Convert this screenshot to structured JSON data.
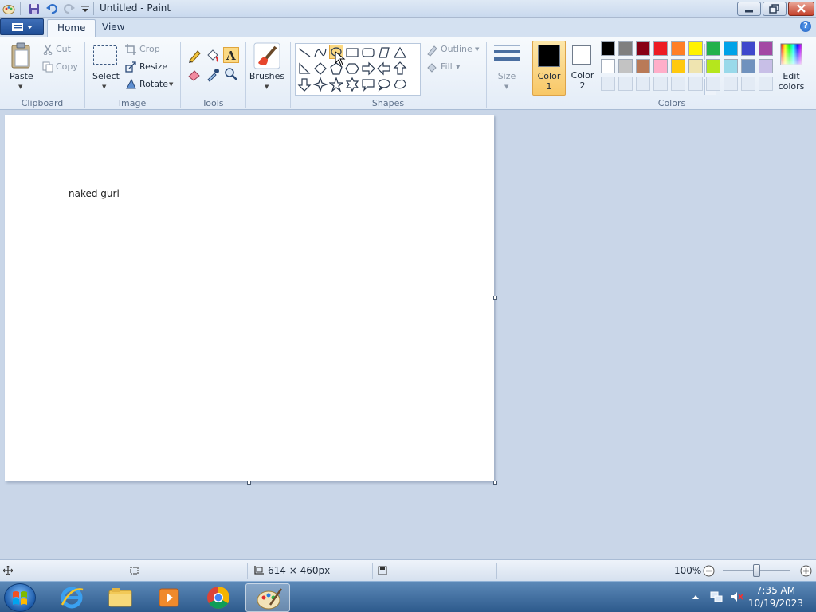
{
  "window": {
    "title": "Untitled - Paint"
  },
  "tabs": {
    "home": "Home",
    "view": "View"
  },
  "ribbon": {
    "clipboard": {
      "paste": "Paste",
      "cut": "Cut",
      "copy": "Copy",
      "group": "Clipboard"
    },
    "image": {
      "select": "Select",
      "crop": "Crop",
      "resize": "Resize",
      "rotate": "Rotate",
      "group": "Image"
    },
    "tools": {
      "group": "Tools"
    },
    "brushes": {
      "label": "Brushes"
    },
    "shapes": {
      "outline": "Outline",
      "fill": "Fill",
      "group": "Shapes"
    },
    "size": {
      "label": "Size"
    },
    "colors": {
      "color1_line1": "Color",
      "color1_line2": "1",
      "color2_line1": "Color",
      "color2_line2": "2",
      "edit_line1": "Edit",
      "edit_line2": "colors",
      "group": "Colors",
      "color1_value": "#000000",
      "color2_value": "#ffffff",
      "palette_row1": [
        "#000000",
        "#7f7f7f",
        "#880015",
        "#ed1c24",
        "#ff7f27",
        "#fff200",
        "#22b14c",
        "#00a2e8",
        "#3f48cc",
        "#a349a4"
      ],
      "palette_row2": [
        "#ffffff",
        "#c3c3c3",
        "#b97a57",
        "#ffaec9",
        "#ffc90e",
        "#efe4b0",
        "#b5e61d",
        "#99d9ea",
        "#7092be",
        "#c8bfe7"
      ]
    }
  },
  "canvas": {
    "text": "naked gurl"
  },
  "status": {
    "dimensions": "614 × 460px",
    "zoom": "100%"
  },
  "taskbar": {
    "time": "7:35 AM",
    "date": "10/19/2023"
  }
}
